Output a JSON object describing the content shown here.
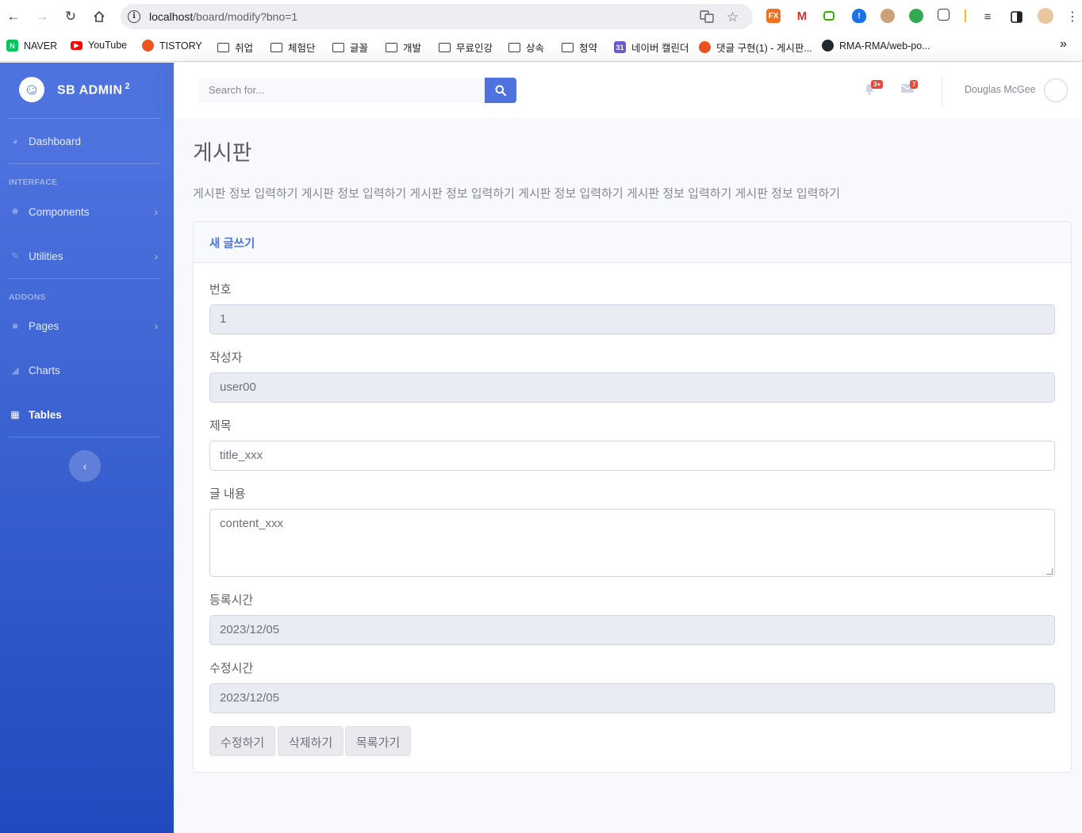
{
  "browser": {
    "url_host": "localhost",
    "url_path": "/board/modify?bno=1",
    "bookmarks": [
      "NAVER",
      "YouTube",
      "TISTORY",
      "취업",
      "체험단",
      "글꼴",
      "개발",
      "무료인강",
      "상속",
      "청약",
      "네이버 캘린더",
      "댓글 구현(1) - 게시판...",
      "RMA-RMA/web-po..."
    ],
    "overflow": "»"
  },
  "sidebar": {
    "brand": "SB ADMIN",
    "brand_sup": "2",
    "items": [
      {
        "label": "Dashboard"
      },
      {
        "label": "Components"
      },
      {
        "label": "Utilities"
      },
      {
        "label": "Pages"
      },
      {
        "label": "Charts"
      },
      {
        "label": "Tables"
      }
    ],
    "headings": [
      "INTERFACE",
      "ADDONS"
    ],
    "active": "Tables"
  },
  "topbar": {
    "search_placeholder": "Search for...",
    "alerts_count": "3+",
    "messages_count": "7",
    "user_name": "Douglas McGee"
  },
  "main": {
    "title": "게시판",
    "description": "게시판 정보 입력하기 게시판 정보 입력하기 게시판 정보 입력하기 게시판 정보 입력하기 게시판 정보 입력하기 게시판 정보 입력하기",
    "card_title": "새 글쓰기",
    "fields": {
      "bno_label": "번호",
      "bno_value": "1",
      "writer_label": "작성자",
      "writer_value": "user00",
      "title_label": "제목",
      "title_value": "title_xxx",
      "content_label": "글 내용",
      "content_value": "content_xxx",
      "regdate_label": "등록시간",
      "regdate_value": "2023/12/05",
      "updatedate_label": "수정시간",
      "updatedate_value": "2023/12/05"
    },
    "buttons": {
      "modify": "수정하기",
      "remove": "삭제하기",
      "list": "목록가기"
    }
  },
  "colors": {
    "primary": "#4e73df",
    "sidebar_end": "#224abe",
    "danger": "#e74a3b"
  }
}
